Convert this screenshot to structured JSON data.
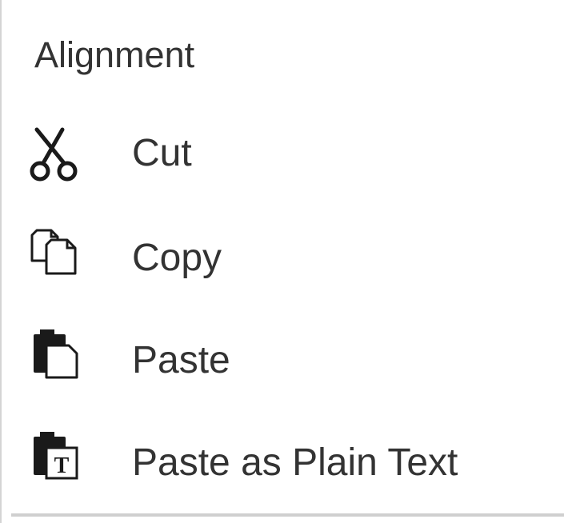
{
  "menu": {
    "header": "Alignment",
    "items": [
      {
        "label": "Cut",
        "icon": "scissors-icon"
      },
      {
        "label": "Copy",
        "icon": "copy-icon"
      },
      {
        "label": "Paste",
        "icon": "paste-icon"
      },
      {
        "label": "Paste as Plain Text",
        "icon": "paste-plain-text-icon"
      }
    ]
  }
}
